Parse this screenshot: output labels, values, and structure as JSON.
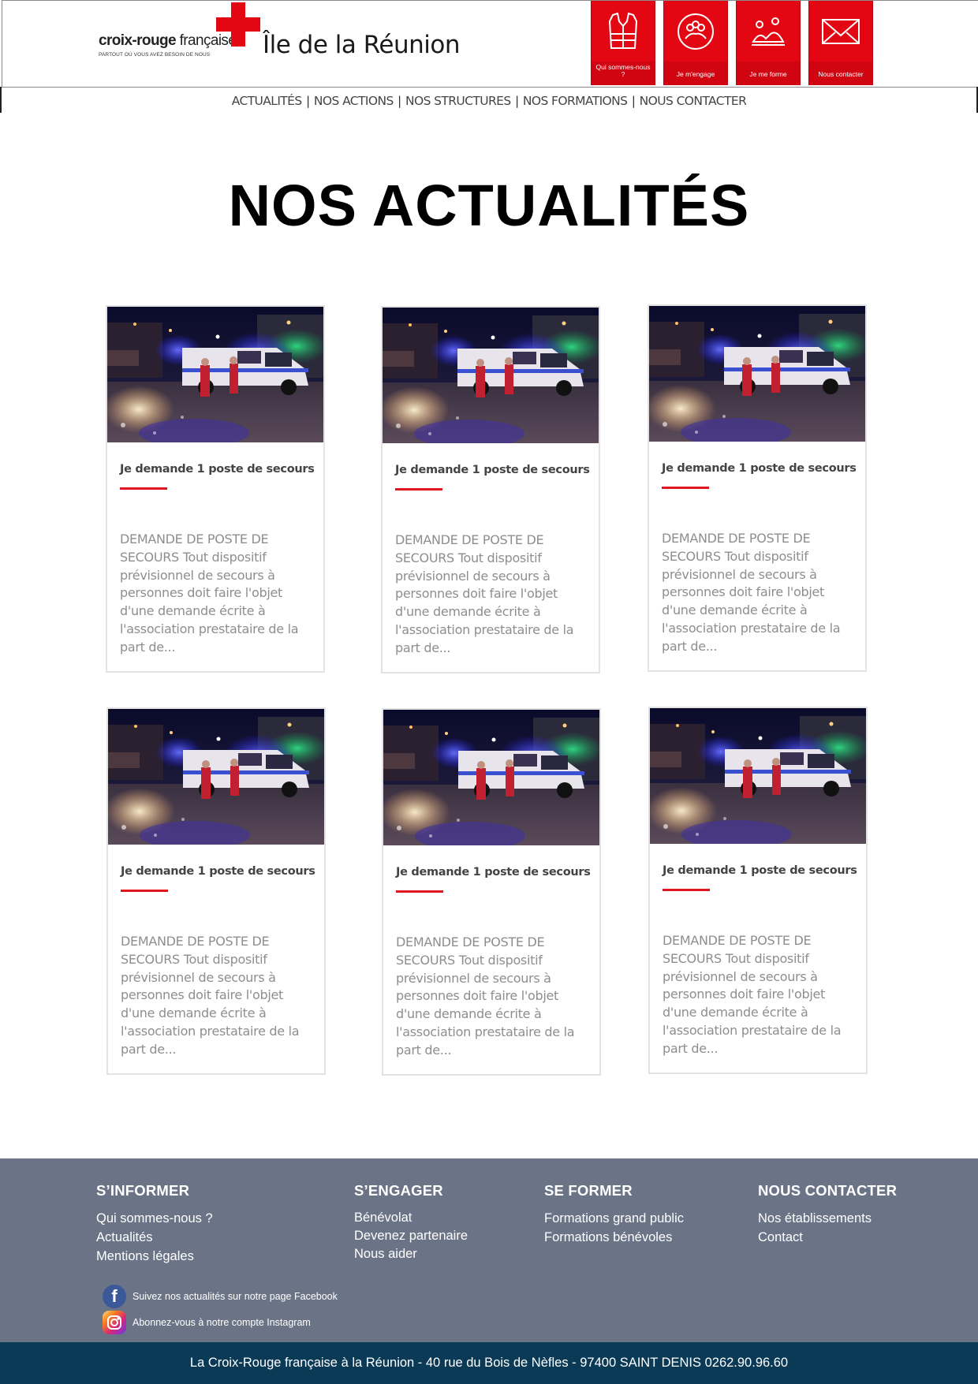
{
  "brand": {
    "logo_name": "croix-rouge",
    "logo_name_suffix": "française",
    "tagline": "PARTOUT OÙ VOUS AVEZ BESOIN DE NOUS",
    "region_title": "Île de la Réunion",
    "accent_color": "#e30613"
  },
  "quick_tiles": [
    {
      "label": "Qui sommes-nous ?",
      "icon": "vest-icon"
    },
    {
      "label": "Je m'engage",
      "icon": "heart-people-icon"
    },
    {
      "label": "Je me forme",
      "icon": "first-aid-training-icon"
    },
    {
      "label": "Nous contacter",
      "icon": "envelope-icon"
    }
  ],
  "topnav": {
    "items": [
      "ACTUALITÉS",
      "NOS ACTIONS",
      "NOS STRUCTURES",
      "NOS FORMATIONS",
      "NOUS CONTACTER"
    ],
    "separator": "|"
  },
  "page_title": "NOS ACTUALITÉS",
  "articles": [
    {
      "title": "Je demande 1 poste de secours",
      "excerpt": "DEMANDE DE POSTE DE SECOURS Tout dispositif prévisionnel de secours à personnes doit faire l'objet d'une demande écrite à l'association prestataire de la part de..."
    },
    {
      "title": "Je demande 1 poste de secours",
      "excerpt": "DEMANDE DE POSTE DE SECOURS Tout dispositif prévisionnel de secours à personnes doit faire l'objet d'une demande écrite à l'association prestataire de la part de..."
    },
    {
      "title": "Je demande 1 poste de secours",
      "excerpt": "DEMANDE DE POSTE DE SECOURS Tout dispositif prévisionnel de secours à personnes doit faire l'objet d'une demande écrite à l'association prestataire de la part de..."
    },
    {
      "title": "Je demande 1 poste de secours",
      "excerpt": "DEMANDE DE POSTE DE SECOURS Tout dispositif prévisionnel de secours à personnes doit faire l'objet d'une demande écrite à l'association prestataire de la part de..."
    },
    {
      "title": "Je demande 1 poste de secours",
      "excerpt": "DEMANDE DE POSTE DE SECOURS Tout dispositif prévisionnel de secours à personnes doit faire l'objet d'une demande écrite à l'association prestataire de la part de..."
    },
    {
      "title": "Je demande 1 poste de secours",
      "excerpt": "DEMANDE DE POSTE DE SECOURS Tout dispositif prévisionnel de secours à personnes doit faire l'objet d'une demande écrite à l'association prestataire de la part de..."
    }
  ],
  "footer": {
    "columns": [
      {
        "heading": "S’INFORMER",
        "links": [
          "Qui sommes-nous ?",
          "Actualités",
          "Mentions légales"
        ]
      },
      {
        "heading": "S’ENGAGER",
        "links": [
          "Bénévolat",
          "Devenez partenaire",
          "Nous aider"
        ]
      },
      {
        "heading": "SE FORMER",
        "links": [
          "Formations grand public",
          "Formations bénévoles"
        ]
      },
      {
        "heading": "NOUS CONTACTER",
        "links": [
          "Nos établissements",
          "Contact"
        ]
      }
    ],
    "social": [
      {
        "icon": "facebook-icon",
        "label": "Suivez nos actualités sur notre page Facebook"
      },
      {
        "icon": "instagram-icon",
        "label": "Abonnez-vous à notre compte Instagram"
      }
    ],
    "background_color": "#6b7486",
    "address": "La Croix-Rouge française à la Réunion - 40 rue du Bois de Nèfles - 97400 SAINT DENIS 0262.90.96.60",
    "address_bar_color": "#0b3a57"
  }
}
